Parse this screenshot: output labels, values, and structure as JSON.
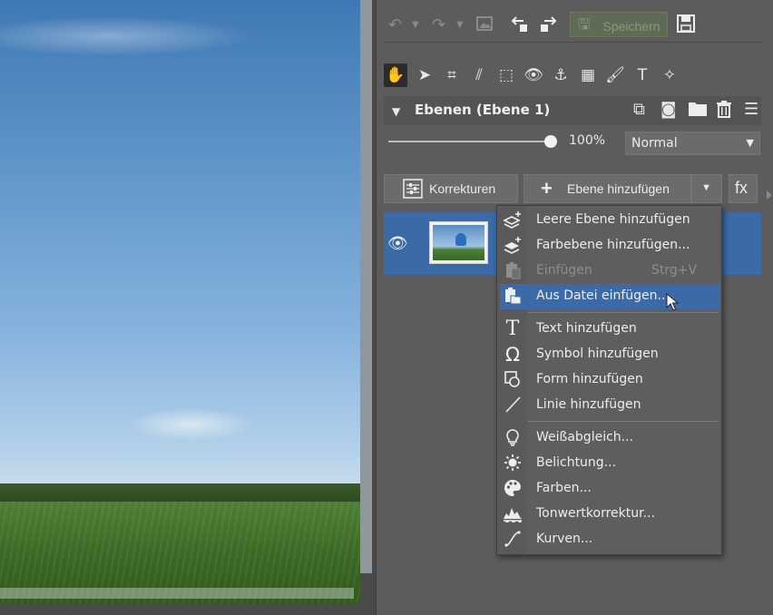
{
  "toolbar": {
    "save_label": "Speichern"
  },
  "layers_panel": {
    "title": "Ebenen (Ebene 1)",
    "opacity": "100%",
    "opacity_fraction": 1.0,
    "blend_mode": "Normal",
    "corrections_label": "Korrekturen",
    "add_layer_label": "Ebene hinzufügen",
    "fx_label": "fx"
  },
  "add_layer_menu": {
    "items": [
      {
        "label": "Leere Ebene hinzufügen",
        "icon": "empty-layer-icon",
        "enabled": true
      },
      {
        "label": "Farbebene hinzufügen...",
        "icon": "color-layer-icon",
        "enabled": true
      },
      {
        "label": "Einfügen",
        "shortcut": "Strg+V",
        "icon": "paste-icon",
        "enabled": false
      },
      {
        "label": "Aus Datei einfügen...",
        "icon": "paste-from-file-icon",
        "enabled": true,
        "highlighted": true
      },
      {
        "label": "Text hinzufügen",
        "icon": "text-icon",
        "enabled": true
      },
      {
        "label": "Symbol hinzufügen",
        "icon": "omega-symbol-icon",
        "enabled": true
      },
      {
        "label": "Form hinzufügen",
        "icon": "shape-icon",
        "enabled": true
      },
      {
        "label": "Linie hinzufügen",
        "icon": "line-icon",
        "enabled": true
      },
      {
        "label": "Weißabgleich...",
        "icon": "light-bulb-icon",
        "enabled": true
      },
      {
        "label": "Belichtung...",
        "icon": "sun-icon",
        "enabled": true
      },
      {
        "label": "Farben...",
        "icon": "palette-icon",
        "enabled": true
      },
      {
        "label": "Tonwertkorrektur...",
        "icon": "levels-icon",
        "enabled": true
      },
      {
        "label": "Kurven...",
        "icon": "curves-icon",
        "enabled": true
      }
    ]
  },
  "colors": {
    "accent": "#3b6aa6",
    "panel": "#5c5c5c",
    "menu": "#5e5e5e"
  }
}
